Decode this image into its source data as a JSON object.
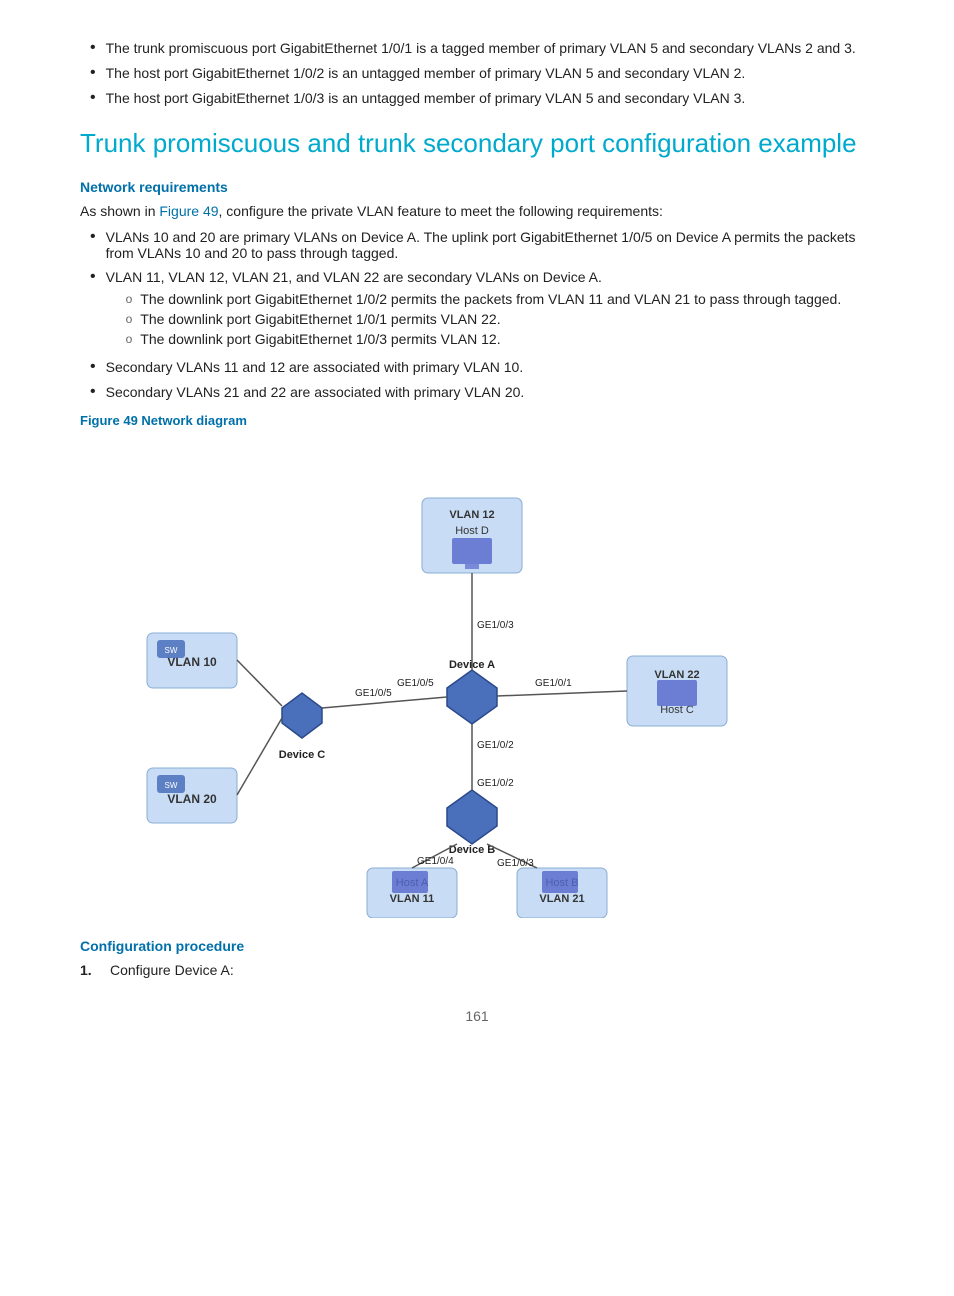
{
  "intro_bullets": [
    "The trunk promiscuous port GigabitEthernet 1/0/1 is a tagged member of primary VLAN 5 and secondary VLANs 2 and 3.",
    "The host port GigabitEthernet 1/0/2 is an untagged member of primary VLAN 5 and secondary VLAN 2.",
    "The host port GigabitEthernet 1/0/3 is an untagged member of primary VLAN 5 and secondary VLAN 3."
  ],
  "section_title": "Trunk promiscuous and trunk secondary port configuration example",
  "network_requirements_heading": "Network requirements",
  "network_req_intro": "As shown in Figure 49, configure the private VLAN feature to meet the following requirements:",
  "figure_link_text": "Figure 49",
  "req_bullets": [
    {
      "text": "VLANs 10 and 20 are primary VLANs on Device A. The uplink port GigabitEthernet 1/0/5 on Device A permits the packets from VLANs 10 and 20 to pass through tagged.",
      "sub": []
    },
    {
      "text": "VLAN 11, VLAN 12, VLAN 21, and VLAN 22 are secondary VLANs on Device A.",
      "sub": [
        "The downlink port GigabitEthernet 1/0/2 permits the packets from VLAN 11 and VLAN 21 to pass through tagged.",
        "The downlink port GigabitEthernet 1/0/1 permits VLAN 22.",
        "The downlink port GigabitEthernet 1/0/3 permits VLAN 12."
      ]
    },
    {
      "text": "Secondary VLANs 11 and 12 are associated with primary VLAN 10.",
      "sub": []
    },
    {
      "text": "Secondary VLANs 21 and 22 are associated with primary VLAN 20.",
      "sub": []
    }
  ],
  "figure_caption": "Figure 49 Network diagram",
  "config_procedure_heading": "Configuration procedure",
  "config_step1": "Configure Device A:",
  "page_number": "161",
  "diagram": {
    "device_a_label": "Device A",
    "device_b_label": "Device B",
    "device_c_label": "Device C",
    "vlan10_label": "VLAN 10",
    "vlan12_label": "VLAN 12",
    "vlan20_label": "VLAN 20",
    "vlan22_label": "VLAN 22",
    "host_a_label": "Host A",
    "host_a_vlan": "VLAN 11",
    "host_b_label": "Host B",
    "host_b_vlan": "VLAN 21",
    "host_c_label": "Host C",
    "host_d_label": "Host D",
    "ge_labels": [
      "GE1/0/3",
      "GE1/0/1",
      "GE1/0/5",
      "GE1/0/5",
      "GE1/0/2",
      "GE1/0/2",
      "GE1/0/4",
      "GE1/0/3"
    ]
  }
}
